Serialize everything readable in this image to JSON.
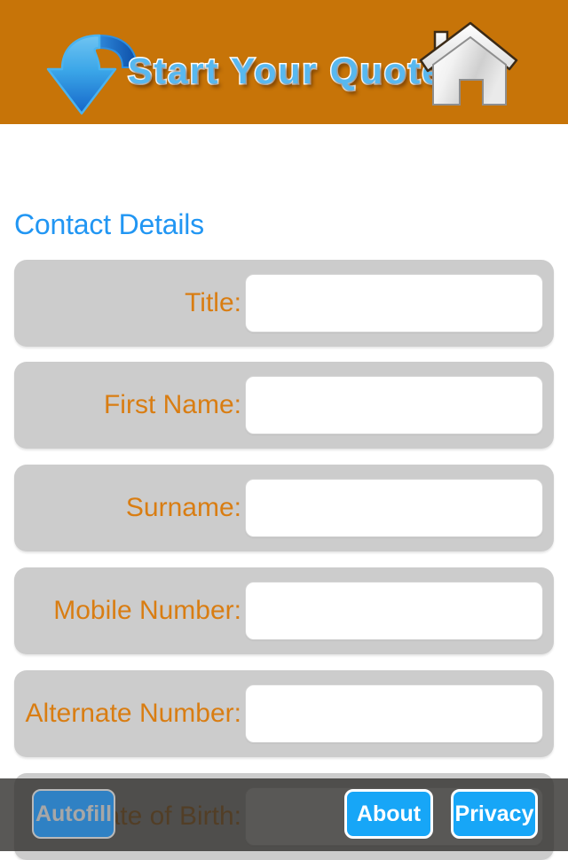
{
  "header": {
    "title": "Start Your Quote",
    "background_color": "#c77408",
    "title_color": "#58b8ef",
    "arrow_icon": "curved-down-arrow-icon",
    "house_icon": "house-icon"
  },
  "main": {
    "section_heading": "Contact Details",
    "section_heading_color": "#2196f3",
    "row_background_color": "#cccccc",
    "label_color": "#d97d12",
    "fields": [
      {
        "label": "Title:",
        "value": "",
        "placeholder": "",
        "name": "title"
      },
      {
        "label": "First Name:",
        "value": "",
        "placeholder": "",
        "name": "first-name"
      },
      {
        "label": "Surname:",
        "value": "",
        "placeholder": "",
        "name": "surname"
      },
      {
        "label": "Mobile Number:",
        "value": "",
        "placeholder": "",
        "name": "mobile-number"
      },
      {
        "label": "Alternate Number:",
        "value": "",
        "placeholder": "",
        "name": "alternate-number"
      },
      {
        "label": "Date of Birth:",
        "value": "",
        "placeholder": "",
        "name": "date-of-birth"
      }
    ]
  },
  "toolbar": {
    "autofill_label": "Autofill",
    "about_label": "About",
    "privacy_label": "Privacy",
    "autofill_enabled": false,
    "button_color": "#17a6f7",
    "autofill_color": "#2f81c4",
    "background_color": "rgba(48,46,44,0.80)"
  }
}
